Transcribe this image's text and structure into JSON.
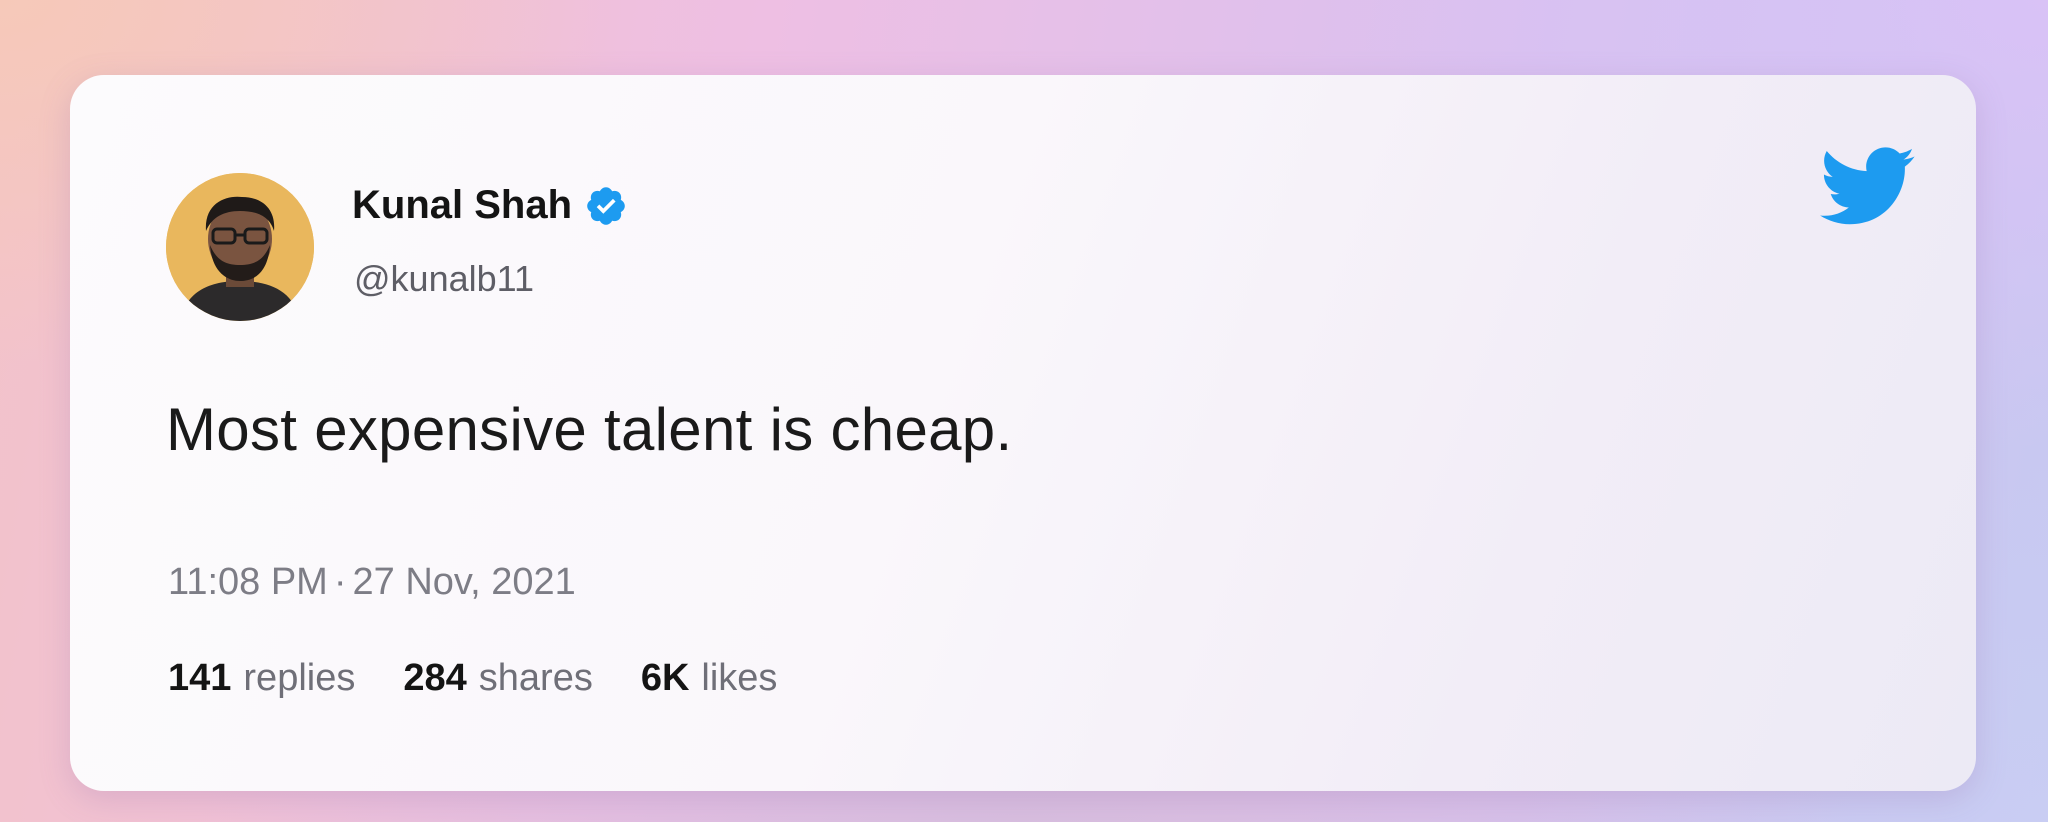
{
  "tweet": {
    "author": {
      "name": "Kunal Shah",
      "handle": "@kunalb11",
      "verified": true,
      "avatar_icon": "profile-photo"
    },
    "text": "Most expensive talent is cheap.",
    "time": "11:08 PM",
    "separator": "·",
    "date": "27 Nov, 2021",
    "stats": {
      "replies_count": "141",
      "replies_label": "replies",
      "shares_count": "284",
      "shares_label": "shares",
      "likes_count": "6K",
      "likes_label": "likes"
    },
    "brand_icon": "twitter-bird-icon"
  },
  "colors": {
    "twitter_blue": "#1d9bf0",
    "verified_blue": "#1d9bf0",
    "text_primary": "#141414",
    "text_secondary": "#6f6f78"
  }
}
